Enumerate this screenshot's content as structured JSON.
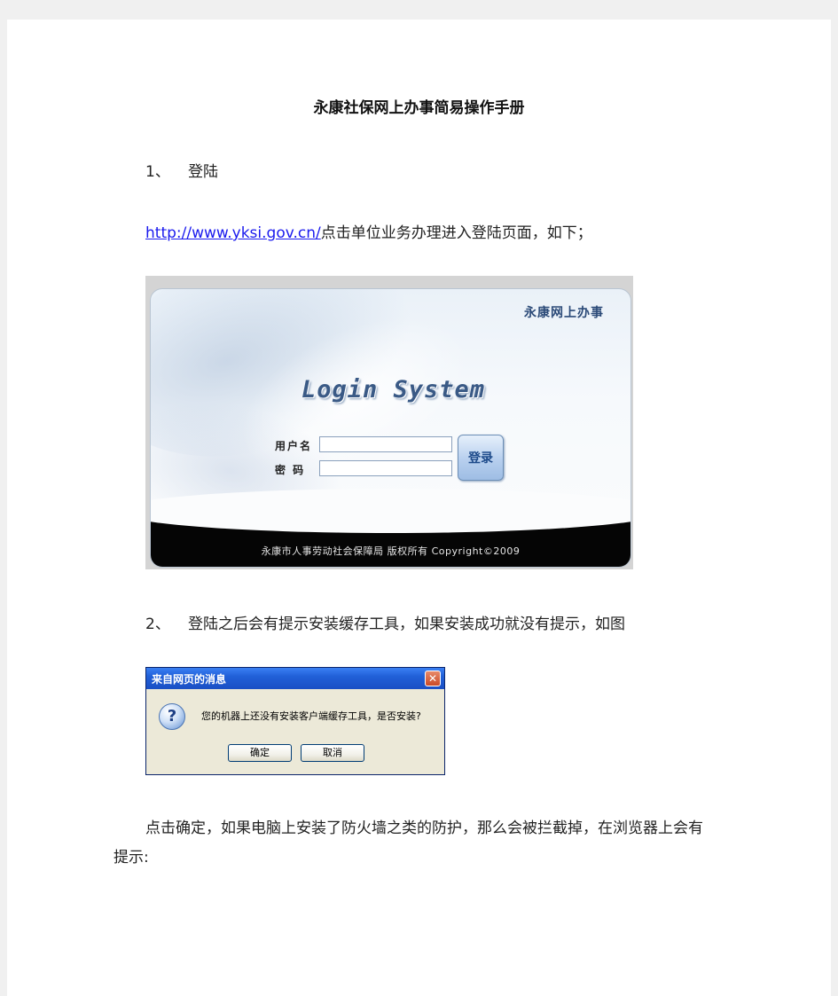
{
  "document": {
    "title": "永康社保网上办事简易操作手册",
    "step1": {
      "number": "1、",
      "text": "登陆"
    },
    "url_link": "http://www.yksi.gov.cn/",
    "url_suffix": "点击单位业务办理进入登陆页面，如下；",
    "step2": {
      "number": "2、",
      "text": "登陆之后会有提示安装缓存工具，如果安装成功就没有提示，如图"
    },
    "para_line1": "点击确定，如果电脑上安装了防火墙之类的防护，那么会被拦截掉，在浏览器上会有",
    "para_line2": "提示:"
  },
  "login_screenshot": {
    "brand": "永康网上办事",
    "system_title": "Login System",
    "username_label": "用户名",
    "password_label": "密  码",
    "login_button": "登录",
    "footer": "永康市人事劳动社会保障局 版权所有 Copyright©2009"
  },
  "dialog_screenshot": {
    "title": "来自网页的消息",
    "close_glyph": "✕",
    "icon_glyph": "?",
    "message": "您的机器上还没有安装客户端缓存工具，是否安装?",
    "ok_button": "确定",
    "cancel_button": "取消"
  }
}
